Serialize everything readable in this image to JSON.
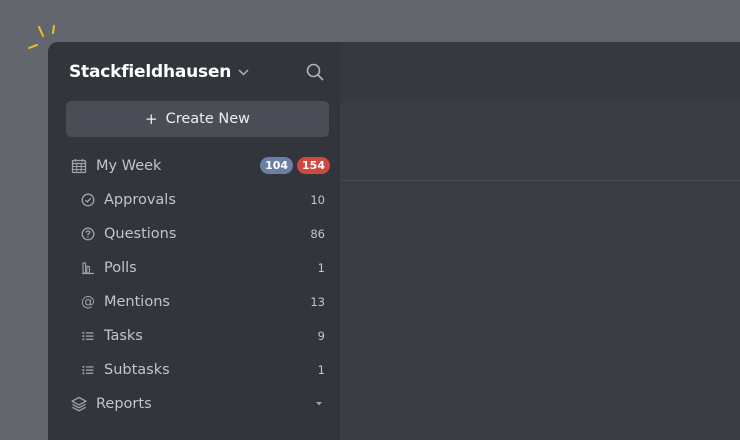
{
  "workspace": {
    "name": "Stackfieldhausen"
  },
  "create_button": {
    "label": "Create New",
    "plus": "+"
  },
  "nav": {
    "my_week": {
      "label": "My Week",
      "badge_blue": "104",
      "badge_red": "154",
      "icon": "calendar-icon"
    },
    "items": [
      {
        "label": "Approvals",
        "count": "10",
        "icon": "check-circle-icon"
      },
      {
        "label": "Questions",
        "count": "86",
        "icon": "question-circle-icon"
      },
      {
        "label": "Polls",
        "count": "1",
        "icon": "poll-icon"
      },
      {
        "label": "Mentions",
        "count": "13",
        "icon": "at-icon"
      },
      {
        "label": "Tasks",
        "count": "9",
        "icon": "list-icon"
      },
      {
        "label": "Subtasks",
        "count": "1",
        "icon": "list-icon"
      }
    ],
    "reports": {
      "label": "Reports",
      "icon": "layers-icon"
    }
  },
  "colors": {
    "background": "#64666d",
    "sidebar": "#33353c",
    "main": "#3a3c44",
    "button": "#4a4d55",
    "badge_blue": "#6b7fa6",
    "badge_red": "#d0483f",
    "sparkle": "#f2c21b"
  }
}
